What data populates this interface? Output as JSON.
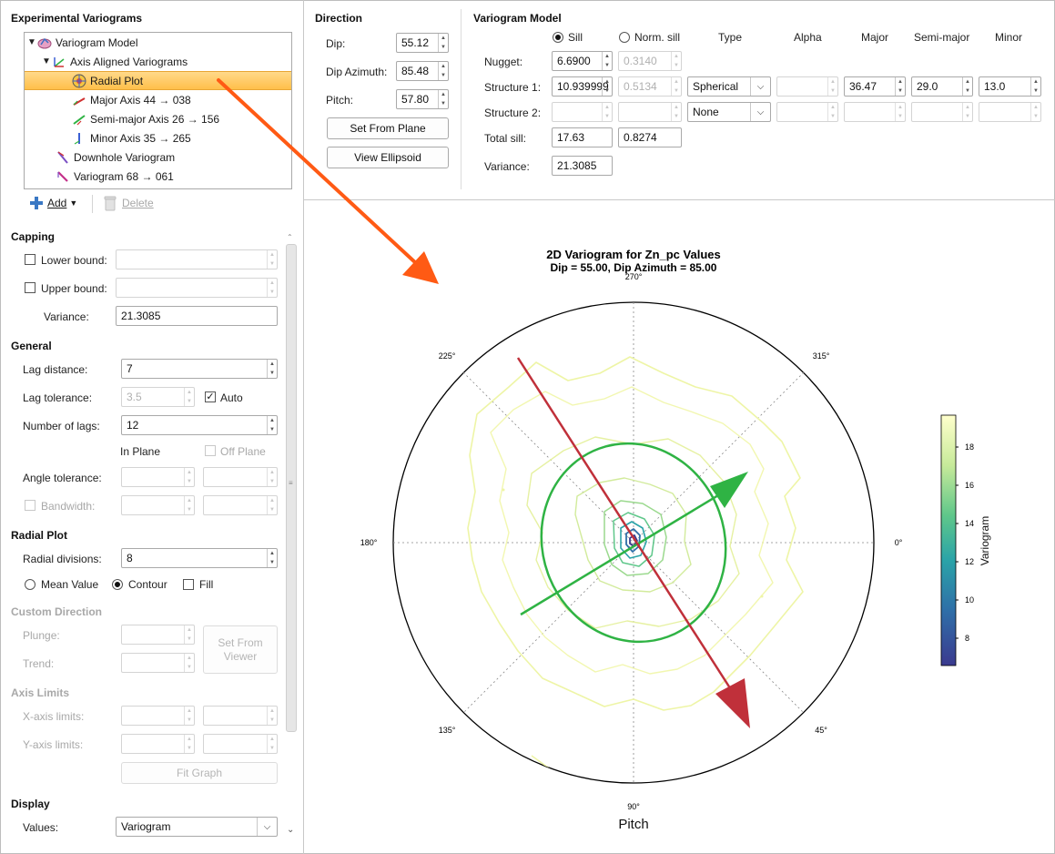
{
  "experimental": {
    "title": "Experimental Variograms",
    "tree": [
      {
        "label": "Variogram Model",
        "toggle": "▼",
        "icon": "variogram-model-icon"
      },
      {
        "label": "Axis Aligned Variograms",
        "toggle": "▼",
        "icon": "axis-aligned-icon"
      },
      {
        "label": "Radial Plot",
        "toggle": "",
        "icon": "radial-plot-icon",
        "selected": true
      },
      {
        "label": "Major Axis 44 → 038",
        "toggle": "",
        "icon": "major-axis-icon"
      },
      {
        "label": "Semi-major Axis 26 → 156",
        "toggle": "",
        "icon": "semi-major-axis-icon"
      },
      {
        "label": "Minor Axis 35 → 265",
        "toggle": "",
        "icon": "minor-axis-icon"
      },
      {
        "label": "Downhole Variogram",
        "toggle": "",
        "icon": "downhole-variogram-icon"
      },
      {
        "label": "Variogram 68 → 061",
        "toggle": "",
        "icon": "variogram-icon"
      }
    ],
    "add_label": "Add",
    "delete_label": "Delete"
  },
  "capping": {
    "title": "Capping",
    "lower_label": "Lower bound:",
    "upper_label": "Upper bound:",
    "variance_label": "Variance:",
    "variance_value": "21.3085"
  },
  "general": {
    "title": "General",
    "lag_distance_label": "Lag distance:",
    "lag_distance_value": "7",
    "lag_tolerance_label": "Lag tolerance:",
    "lag_tolerance_value": "3.5",
    "auto_label": "Auto",
    "num_lags_label": "Number of lags:",
    "num_lags_value": "12",
    "in_plane_label": "In Plane",
    "off_plane_label": "Off Plane",
    "angle_tolerance_label": "Angle tolerance:",
    "bandwidth_label": "Bandwidth:"
  },
  "radial": {
    "title": "Radial Plot",
    "divisions_label": "Radial divisions:",
    "divisions_value": "8",
    "mean_label": "Mean Value",
    "contour_label": "Contour",
    "fill_label": "Fill"
  },
  "custom": {
    "title": "Custom Direction",
    "plunge_label": "Plunge:",
    "trend_label": "Trend:",
    "set_from_viewer": "Set From Viewer"
  },
  "axis_limits": {
    "title": "Axis Limits",
    "x_label": "X-axis limits:",
    "y_label": "Y-axis limits:",
    "fit_graph": "Fit Graph"
  },
  "display": {
    "title": "Display",
    "values_label": "Values:",
    "values_value": "Variogram"
  },
  "direction": {
    "title": "Direction",
    "dip_label": "Dip:",
    "dip_value": "55.12",
    "dip_az_label": "Dip Azimuth:",
    "dip_az_value": "85.48",
    "pitch_label": "Pitch:",
    "pitch_value": "57.80",
    "set_from_plane": "Set From Plane",
    "view_ellipsoid": "View Ellipsoid"
  },
  "model": {
    "title": "Variogram Model",
    "sill_label": "Sill",
    "norm_sill_label": "Norm. sill",
    "headers": [
      "Type",
      "Alpha",
      "Major",
      "Semi-major",
      "Minor"
    ],
    "nugget_label": "Nugget:",
    "nugget_sill": "6.6900",
    "nugget_norm": "0.3140",
    "s1_label": "Structure 1:",
    "s1_sill": "10.939999",
    "s1_norm": "0.5134",
    "s1_type": "Spherical",
    "s1_major": "36.47",
    "s1_semi": "29.0",
    "s1_minor": "13.0",
    "s2_label": "Structure 2:",
    "s2_type": "None",
    "total_label": "Total sill:",
    "total_sill": "17.63",
    "total_norm": "0.8274",
    "variance_label": "Variance:",
    "variance_value": "21.3085"
  },
  "chart_data": {
    "type": "contour",
    "title": "2D Variogram for Zn_pc Values",
    "subtitle": "Dip = 55.00, Dip Azimuth = 85.00",
    "xlabel": "Pitch",
    "angle_labels": [
      "0°",
      "45°",
      "90°",
      "135°",
      "180°",
      "225°",
      "270°",
      "315°"
    ],
    "colorbar_label": "Variogram",
    "colorbar_ticks": [
      "8",
      "10",
      "12",
      "14",
      "16",
      "18"
    ],
    "colorbar_range": [
      6.5,
      19.7
    ],
    "colors": {
      "low": "#3b3a8f",
      "mid": "#2db3a0",
      "high": "#ffffcc",
      "major_arrow": "#c0303a",
      "minor_arrow": "#2fb344",
      "ellipse": "#2fb344"
    }
  }
}
